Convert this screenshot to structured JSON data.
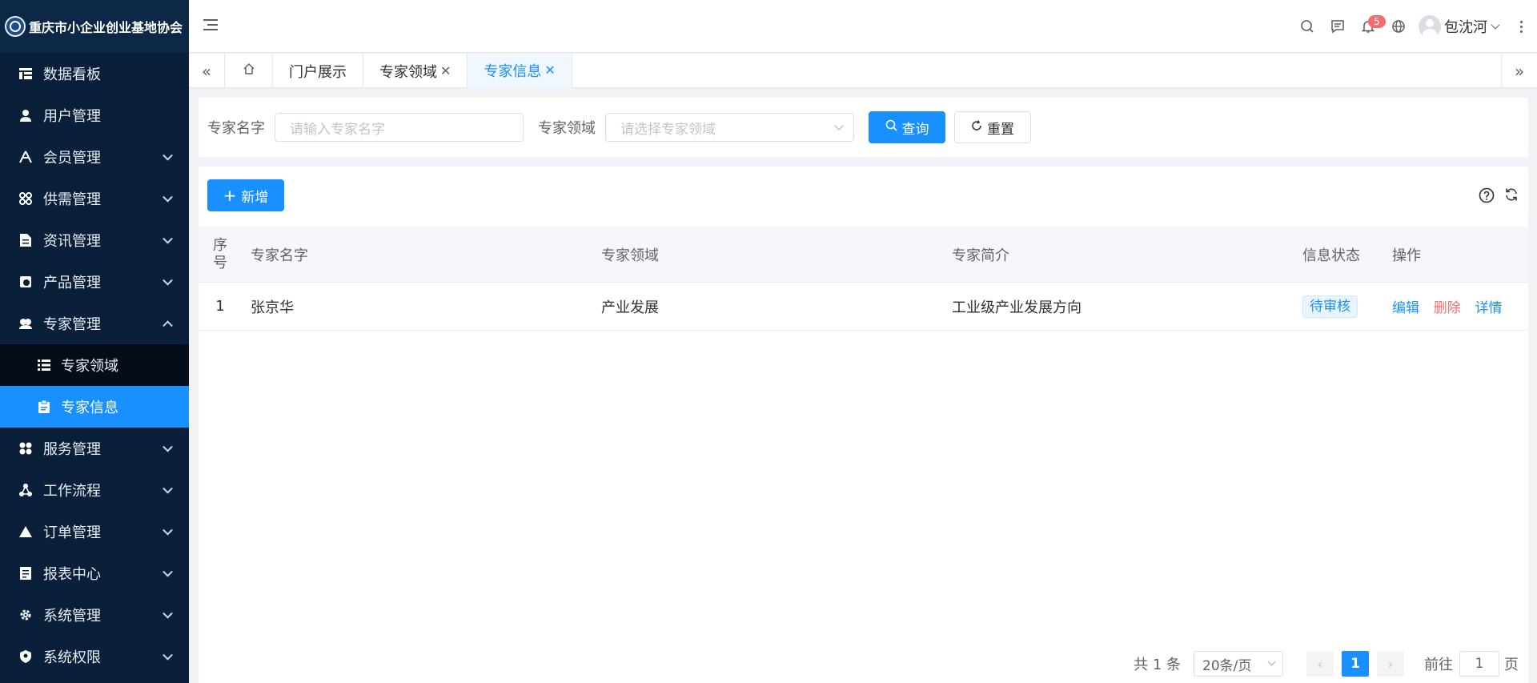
{
  "app": {
    "title": "重庆市小企业创业基地协会"
  },
  "sidebar": {
    "items": [
      {
        "label": "数据看板",
        "icon": "dashboard-icon",
        "expandable": false
      },
      {
        "label": "用户管理",
        "icon": "user-icon",
        "expandable": false
      },
      {
        "label": "会员管理",
        "icon": "member-icon",
        "expandable": true
      },
      {
        "label": "供需管理",
        "icon": "supply-icon",
        "expandable": true
      },
      {
        "label": "资讯管理",
        "icon": "news-icon",
        "expandable": true
      },
      {
        "label": "产品管理",
        "icon": "product-icon",
        "expandable": true
      },
      {
        "label": "专家管理",
        "icon": "expert-icon",
        "expandable": true,
        "expanded": true
      }
    ],
    "sub_items": [
      {
        "label": "专家领域",
        "icon": "list-icon",
        "active": false
      },
      {
        "label": "专家信息",
        "icon": "clipboard-icon",
        "active": true
      }
    ],
    "items_after": [
      {
        "label": "服务管理",
        "icon": "service-icon"
      },
      {
        "label": "工作流程",
        "icon": "workflow-icon"
      },
      {
        "label": "订单管理",
        "icon": "order-icon"
      },
      {
        "label": "报表中心",
        "icon": "report-icon"
      },
      {
        "label": "系统管理",
        "icon": "settings-icon"
      },
      {
        "label": "系统权限",
        "icon": "shield-icon"
      }
    ]
  },
  "header": {
    "notification_count": "5",
    "username": "包沈河"
  },
  "tabs": [
    {
      "label": "门户展示",
      "closable": false,
      "active": false
    },
    {
      "label": "专家领域",
      "closable": true,
      "active": false
    },
    {
      "label": "专家信息",
      "closable": true,
      "active": true
    }
  ],
  "search": {
    "name_label": "专家名字",
    "name_placeholder": "请输入专家名字",
    "field_label": "专家领域",
    "field_placeholder": "请选择专家领域",
    "query_label": "查询",
    "reset_label": "重置"
  },
  "toolbar": {
    "add_label": "新增"
  },
  "table": {
    "columns": {
      "index": "序号",
      "name": "专家名字",
      "field": "专家领域",
      "intro": "专家简介",
      "status": "信息状态",
      "ops": "操作"
    },
    "rows": [
      {
        "index": "1",
        "name": "张京华",
        "field": "产业发展",
        "intro": "工业级产业发展方向",
        "status": "待审核",
        "edit": "编辑",
        "delete": "删除",
        "detail": "详情"
      }
    ]
  },
  "pagination": {
    "total": "共 1 条",
    "page_size": "20条/页",
    "current_page": "1",
    "goto_label": "前往",
    "goto_value": "1",
    "page_suffix": "页"
  },
  "colors": {
    "primary": "#1890ff",
    "sidebar_bg": "#0a1f3a",
    "danger": "#f56c6c"
  }
}
